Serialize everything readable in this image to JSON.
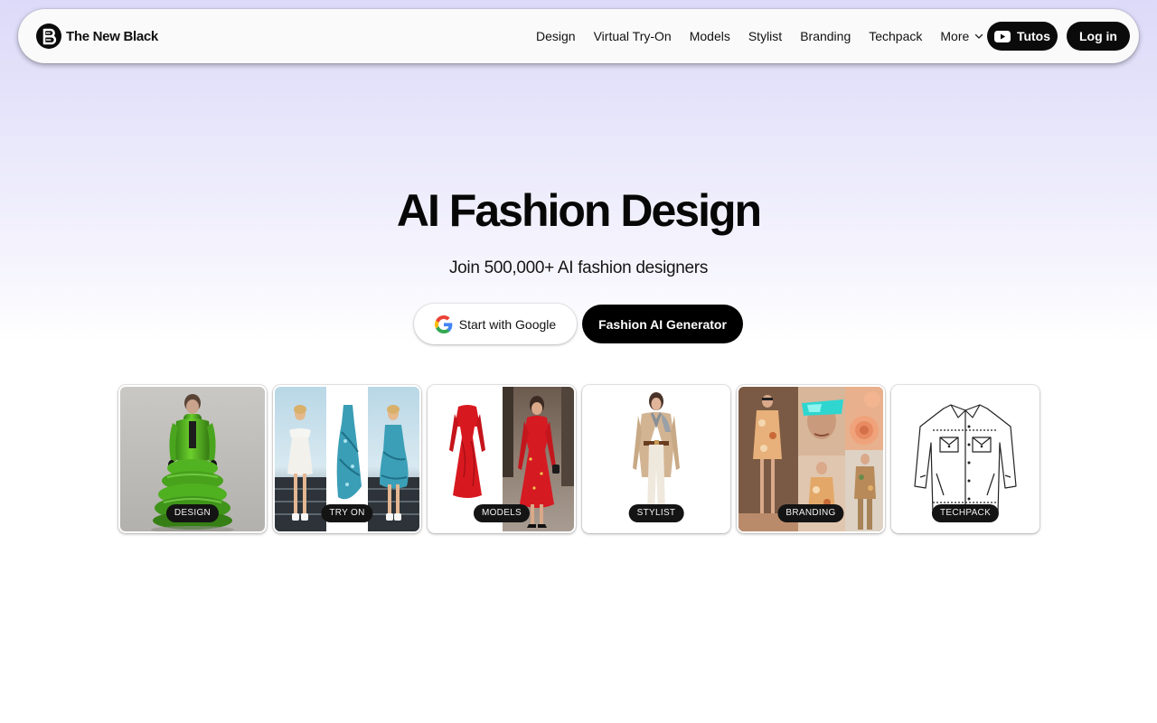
{
  "brand": {
    "name": "The New Black",
    "logo_icon": "brand-b-logo-icon"
  },
  "nav": {
    "links": [
      "Design",
      "Virtual Try-On",
      "Models",
      "Stylist",
      "Branding",
      "Techpack"
    ],
    "more_label": "More",
    "more_icon": "chevron-down-icon",
    "tutos_label": "Tutos",
    "tutos_icon": "youtube-play-icon",
    "login_label": "Log in"
  },
  "hero": {
    "title": "AI Fashion Design",
    "subtitle": "Join 500,000+ AI fashion designers",
    "google_button": "Start with Google",
    "google_icon": "google-g-icon",
    "generator_button": "Fashion AI Generator"
  },
  "cards": [
    {
      "label": "DESIGN",
      "image": "green-puffer-coat-model"
    },
    {
      "label": "TRY ON",
      "image": "dress-try-on-triptych"
    },
    {
      "label": "MODELS",
      "image": "red-dress-models"
    },
    {
      "label": "STYLIST",
      "image": "camel-coat-outfit"
    },
    {
      "label": "BRANDING",
      "image": "floral-print-moodboard"
    },
    {
      "label": "TECHPACK",
      "image": "denim-jacket-sketch"
    }
  ],
  "colors": {
    "background_top": "#dcdaf8",
    "background_bottom": "#ffffff",
    "primary_button": "#0b0b0b",
    "label_pill": "#141414"
  }
}
